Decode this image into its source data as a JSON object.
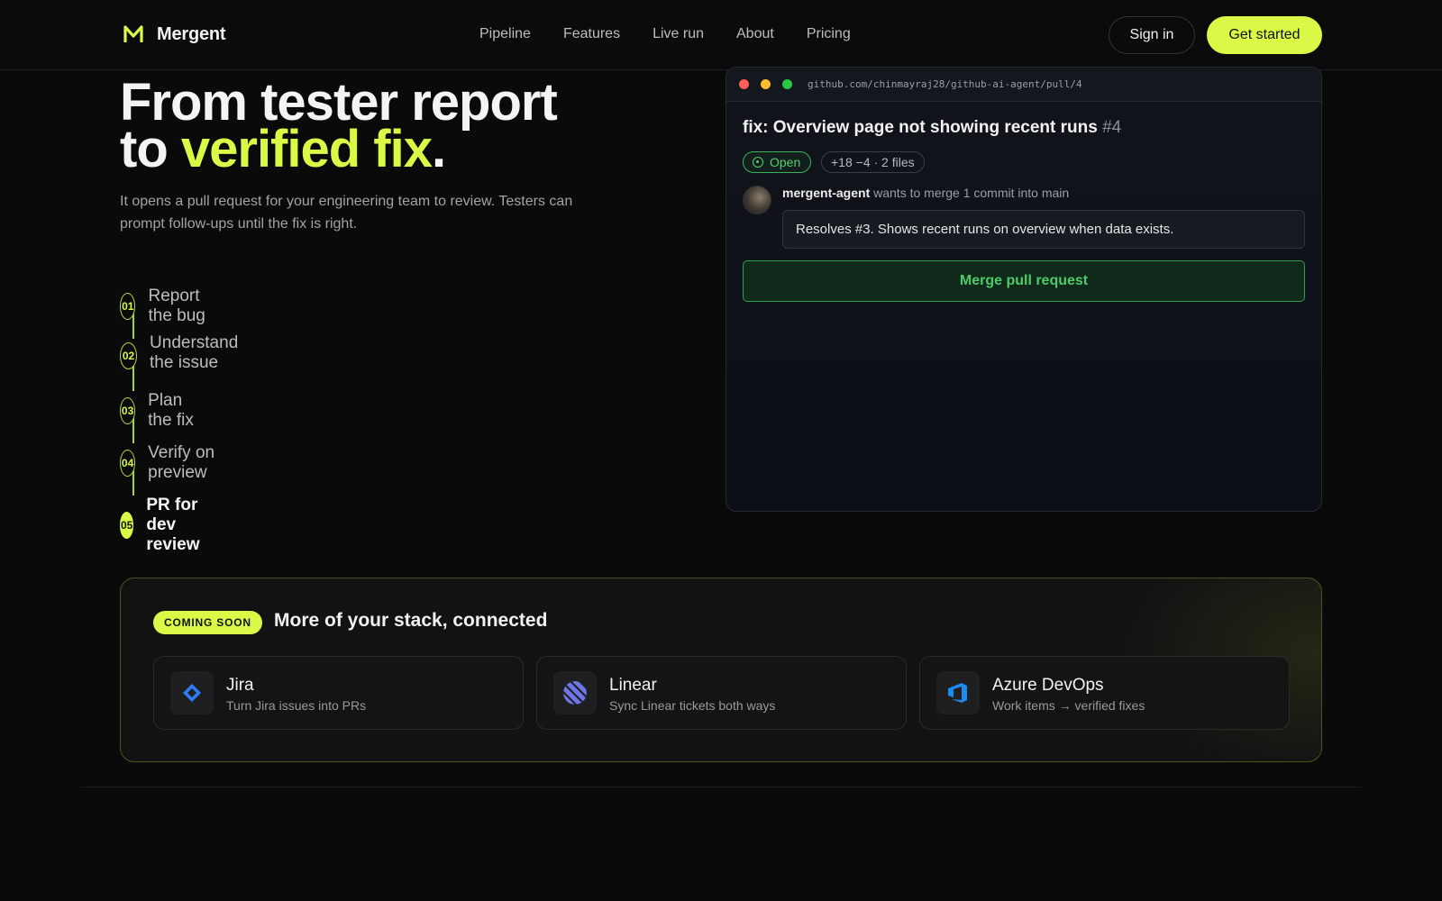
{
  "brand": {
    "name": "Mergent",
    "accent": "#d9f946"
  },
  "nav": {
    "items": [
      "Pipeline",
      "Features",
      "Live run",
      "About",
      "Pricing"
    ]
  },
  "header": {
    "signin_label": "Sign in",
    "cta_label": "Get started"
  },
  "hero": {
    "title_line1": "From tester report",
    "title_to": "to ",
    "title_highlight": "verified fix",
    "title_period": ".",
    "description": "It opens a pull request for your engineering team to review. Testers can prompt follow-ups until the fix is right."
  },
  "steps": [
    {
      "num": "01",
      "label": "Report the bug"
    },
    {
      "num": "02",
      "label": "Understand the issue"
    },
    {
      "num": "03",
      "label": "Plan the fix"
    },
    {
      "num": "04",
      "label": "Verify on preview"
    },
    {
      "num": "05",
      "label": "PR for dev review",
      "active": true
    }
  ],
  "pr": {
    "url": "github.com/chinmayraj28/github-ai-agent/pull/4",
    "title": "fix: Overview page not showing recent runs",
    "number": "#4",
    "status": "Open",
    "diff": "+18 −4 · 2 files",
    "author": "mergent-agent",
    "merge_text": "wants to merge 1 commit into main",
    "comment": "Resolves #3. Shows recent runs on overview when data exists.",
    "merge_button": "Merge pull request"
  },
  "coming_soon": {
    "badge": "COMING SOON",
    "title": "More of your stack, connected",
    "integrations": [
      {
        "name": "Jira",
        "desc": "Turn Jira issues into PRs",
        "icon": "jira-icon"
      },
      {
        "name": "Linear",
        "desc": "Sync Linear tickets both ways",
        "icon": "linear-icon"
      },
      {
        "name": "Azure DevOps",
        "desc": "Work items → verified fixes",
        "icon": "azure-devops-icon"
      }
    ]
  }
}
